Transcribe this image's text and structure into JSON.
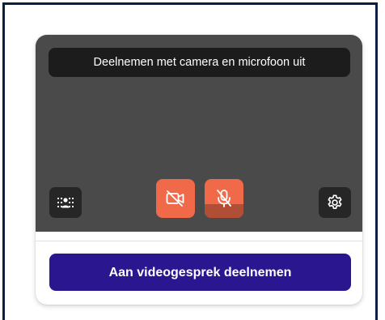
{
  "preview": {
    "status_text": "Deelnemen met camera en microfoon uit",
    "background_color": "#4a4a4a"
  },
  "controls": {
    "effects_icon": "background-effects-icon",
    "camera_icon": "camera-off-icon",
    "microphone_icon": "microphone-off-icon",
    "settings_icon": "gear-icon",
    "toggle_off_color": "#f06a4a"
  },
  "join": {
    "label": "Aan videogesprek deelnemen",
    "color": "#2a168f"
  }
}
